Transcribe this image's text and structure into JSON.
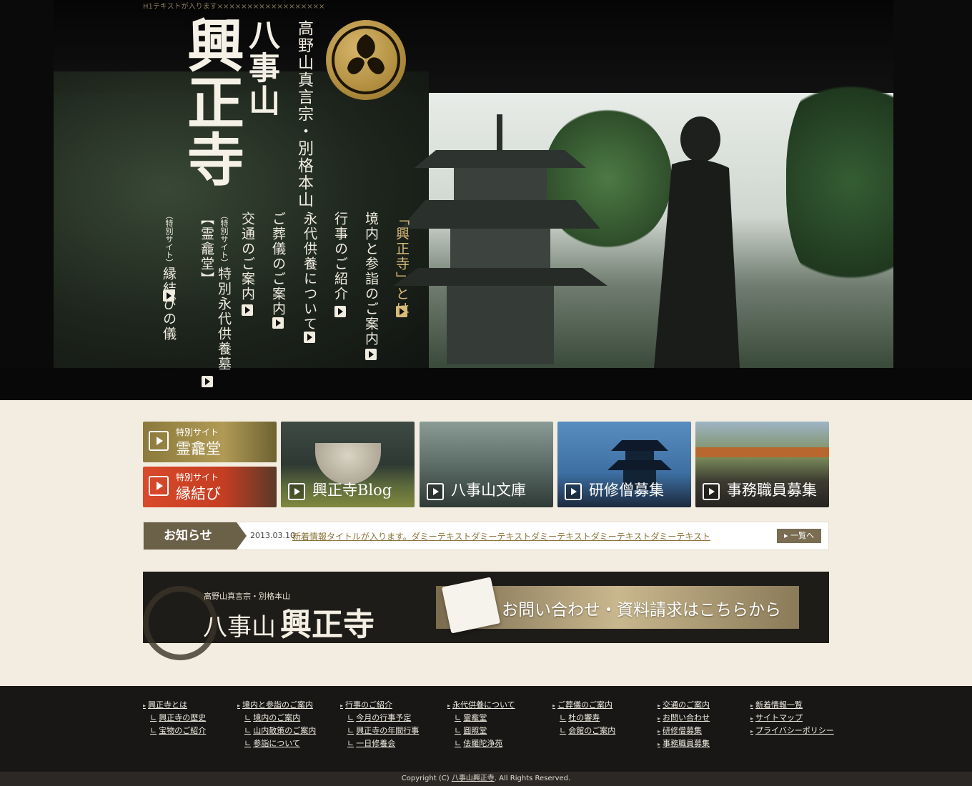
{
  "hero": {
    "h1_text": "H1テキストが入ります××××××××××××××××××",
    "temple_name": "興正寺",
    "mountain_name": "八事山",
    "sect": "高野山真言宗・別格本山",
    "nav": [
      {
        "label": "「興正寺」とは"
      },
      {
        "label": "境内と参詣のご案内"
      },
      {
        "label": "行事のご紹介"
      },
      {
        "label": "永代供養について"
      },
      {
        "label": "ご葬儀のご案内"
      },
      {
        "label": "交通のご案内"
      },
      {
        "prefix": "（特別サイト）",
        "label": "特別永代供養墓【霊龕堂】"
      },
      {
        "prefix": "（特別サイト）",
        "label": "縁結びの儀"
      }
    ]
  },
  "banners": {
    "reigando": {
      "sub": "特別サイト",
      "main": "霊龕堂"
    },
    "enmusubi": {
      "sub": "特別サイト",
      "main": "縁結び"
    },
    "blog": "興正寺Blog",
    "bunko": "八事山文庫",
    "kenshu": "研修僧募集",
    "jimu": "事務職員募集"
  },
  "news": {
    "tag": "お知らせ",
    "date": "2013.03.10",
    "title": "新着情報タイトルが入ります。ダミーテキストダミーテキストダミーテキストダミーテキストダミーテキスト",
    "more": "▸ 一覧へ"
  },
  "contact": {
    "sect": "高野山真言宗・別格本山",
    "mountain": "八事山",
    "temple": "興正寺",
    "button": "お問い合わせ・資料請求はこちらから"
  },
  "footer": {
    "cols": [
      {
        "head": "興正寺とは",
        "subs": [
          "興正寺の歴史",
          "宝物のご紹介"
        ]
      },
      {
        "head": "境内と参詣のご案内",
        "subs": [
          "境内のご案内",
          "山内散策のご案内",
          "参詣について"
        ]
      },
      {
        "head": "行事のご紹介",
        "subs": [
          "今月の行事予定",
          "興正寺の年間行事",
          "一日修養会"
        ]
      },
      {
        "head": "永代供養について",
        "subs": [
          "霊龕堂",
          "圓照堂",
          "佉羅陀浄苑"
        ]
      },
      {
        "head": "ご葬儀のご案内",
        "subs": [
          "杜の響寿",
          "会館のご案内"
        ]
      },
      {
        "head": "交通のご案内",
        "heads": [
          "お問い合わせ",
          "研修僧募集",
          "事務職員募集"
        ]
      },
      {
        "head": "新着情報一覧",
        "heads": [
          "サイトマップ",
          "プライバシーポリシー"
        ]
      }
    ],
    "copyright_pre": "Copyright (C) ",
    "copyright_name": "八事山興正寺",
    "copyright_post": ". All Rights Reserved."
  },
  "colors": {
    "gold": "#d7bb79",
    "news_tag": "#6b6048",
    "footer_bg": "#181716",
    "page_bg": "#f2ede0"
  }
}
